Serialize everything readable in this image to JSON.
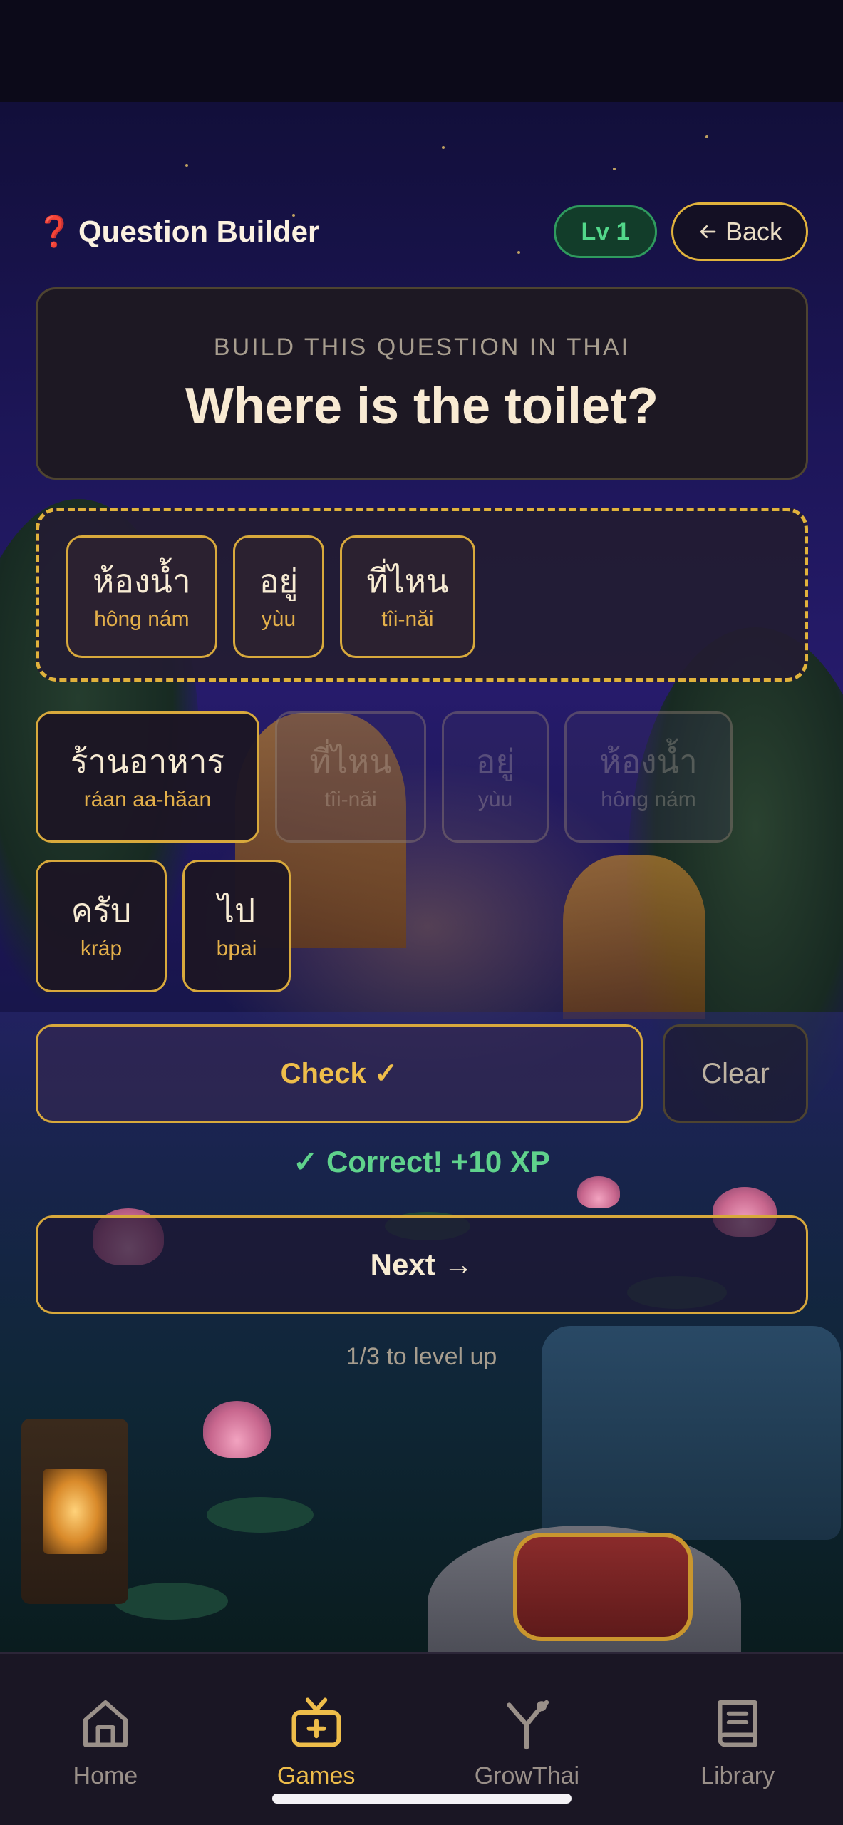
{
  "header": {
    "icon": "question-mark-icon",
    "icon_glyph": "❓",
    "title": "Question Builder",
    "level": "Lv 1",
    "back_label": "Back",
    "back_icon": "arrow-left-icon"
  },
  "prompt": {
    "label": "BUILD THIS QUESTION IN THAI",
    "text": "Where is the toilet?"
  },
  "answer": [
    {
      "thai": "ห้องน้ำ",
      "roman": "hông nám"
    },
    {
      "thai": "อยู่",
      "roman": "yùu"
    },
    {
      "thai": "ที่ไหน",
      "roman": "tîi-năi"
    }
  ],
  "bank": [
    {
      "thai": "ร้านอาหาร",
      "roman": "ráan aa-hăan",
      "used": false
    },
    {
      "thai": "ที่ไหน",
      "roman": "tîi-năi",
      "used": true
    },
    {
      "thai": "อยู่",
      "roman": "yùu",
      "used": true
    },
    {
      "thai": "ห้องน้ำ",
      "roman": "hông nám",
      "used": true
    },
    {
      "thai": "ครับ",
      "roman": "kráp",
      "used": false
    },
    {
      "thai": "ไป",
      "roman": "bpai",
      "used": false
    }
  ],
  "actions": {
    "check_label": "Check ✓",
    "clear_label": "Clear",
    "feedback": "✓ Correct! +10 XP",
    "next_label": "Next →",
    "progress": "1/3 to level up"
  },
  "nav": [
    {
      "label": "Home",
      "icon": "home-icon",
      "active": false
    },
    {
      "label": "Games",
      "icon": "games-tv-icon",
      "active": true
    },
    {
      "label": "GrowThai",
      "icon": "growthai-figure-icon",
      "active": false
    },
    {
      "label": "Library",
      "icon": "book-icon",
      "active": false
    }
  ],
  "colors": {
    "accent_gold": "#e0b23c",
    "success_green": "#5fd28c",
    "level_badge_bg": "#123d2a"
  }
}
